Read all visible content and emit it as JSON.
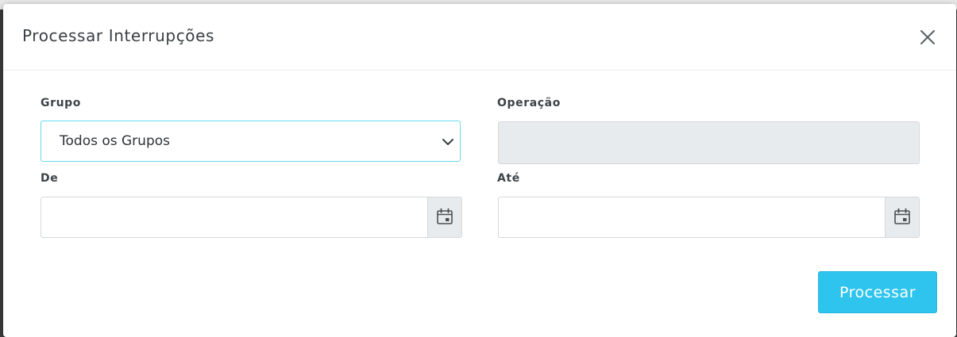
{
  "modal": {
    "title": "Processar Interrupções",
    "close_icon": "close-icon"
  },
  "form": {
    "grupo": {
      "label": "Grupo",
      "selected_value": "Todos os Grupos",
      "icon": "chevron-down-icon"
    },
    "operacao": {
      "label": "Operação",
      "value": ""
    },
    "de": {
      "label": "De",
      "value": "",
      "icon": "calendar-icon"
    },
    "ate": {
      "label": "Até",
      "value": "",
      "icon": "calendar-icon"
    }
  },
  "actions": {
    "process_label": "Processar"
  },
  "colors": {
    "primary": "#2ec4ee",
    "focus_border": "#66d9f0",
    "disabled_bg": "#e8ebee",
    "text": "#3a3f44"
  }
}
